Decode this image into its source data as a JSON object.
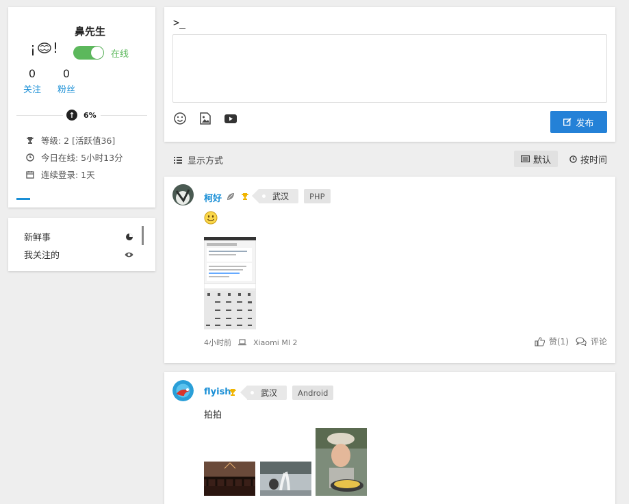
{
  "profile": {
    "username": "鼻先生",
    "status": "在线",
    "follow_count": "0",
    "follow_label": "关注",
    "fans_count": "0",
    "fans_label": "粉丝",
    "level_pct": "6%",
    "level_progress": 0.06,
    "level_text": "等级: 2  [活跃值36]",
    "online_text": "今日在线: 5小时13分",
    "login_text": "连续登录: 1天"
  },
  "nav": {
    "items": [
      {
        "label": "新鲜事",
        "icon": "pie-chart-icon"
      },
      {
        "label": "我关注的",
        "icon": "eye-icon"
      }
    ]
  },
  "composer": {
    "prompt": ">_",
    "textarea_value": "",
    "publish_label": "发布"
  },
  "display": {
    "label": "显示方式",
    "default_label": "默认",
    "time_label": "按时间"
  },
  "posts": [
    {
      "author": "柯好",
      "city": "武汉",
      "tag": "PHP",
      "time": "4小时前",
      "device": "Xiaomi MI 2",
      "like_label": "赞(1)",
      "comment_label": "评论"
    },
    {
      "author": "flyish",
      "city": "武汉",
      "tag": "Android",
      "text": "拍拍"
    }
  ],
  "colors": {
    "accent": "#1a8fd6",
    "online": "#5cb85c",
    "publish": "#2481d7"
  }
}
